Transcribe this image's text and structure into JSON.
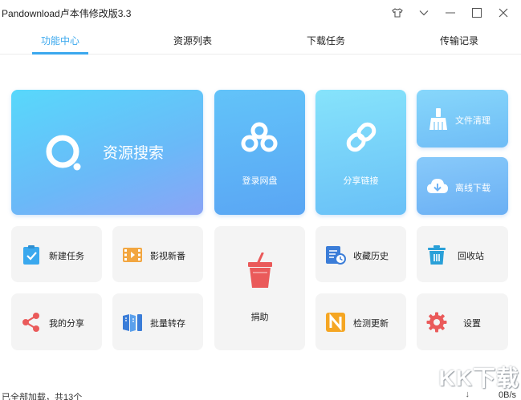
{
  "window": {
    "title": "Pandownload卢本伟修改版3.3"
  },
  "tabs": [
    {
      "label": "功能中心",
      "active": true
    },
    {
      "label": "资源列表",
      "active": false
    },
    {
      "label": "下载任务",
      "active": false
    },
    {
      "label": "传输记录",
      "active": false
    }
  ],
  "tiles": {
    "search": "资源搜索",
    "login": "登录网盘",
    "share_link": "分享链接",
    "file_clean": "文件清理",
    "offline_download": "离线下载",
    "new_task": "新建任务",
    "movies": "影视新番",
    "donate": "捐助",
    "favorites": "收藏历史",
    "recycle": "回收站",
    "my_share": "我的分享",
    "batch_transfer": "批量转存",
    "check_update": "检测更新",
    "settings": "设置"
  },
  "status": {
    "left": "已全部加载，共13个",
    "speed": "0B/s"
  },
  "watermark": "KK下载",
  "colors": {
    "accent": "#3aa8ee",
    "tile_gradient_start": "#58d8fb",
    "tile_gradient_end": "#8ba4f6"
  }
}
